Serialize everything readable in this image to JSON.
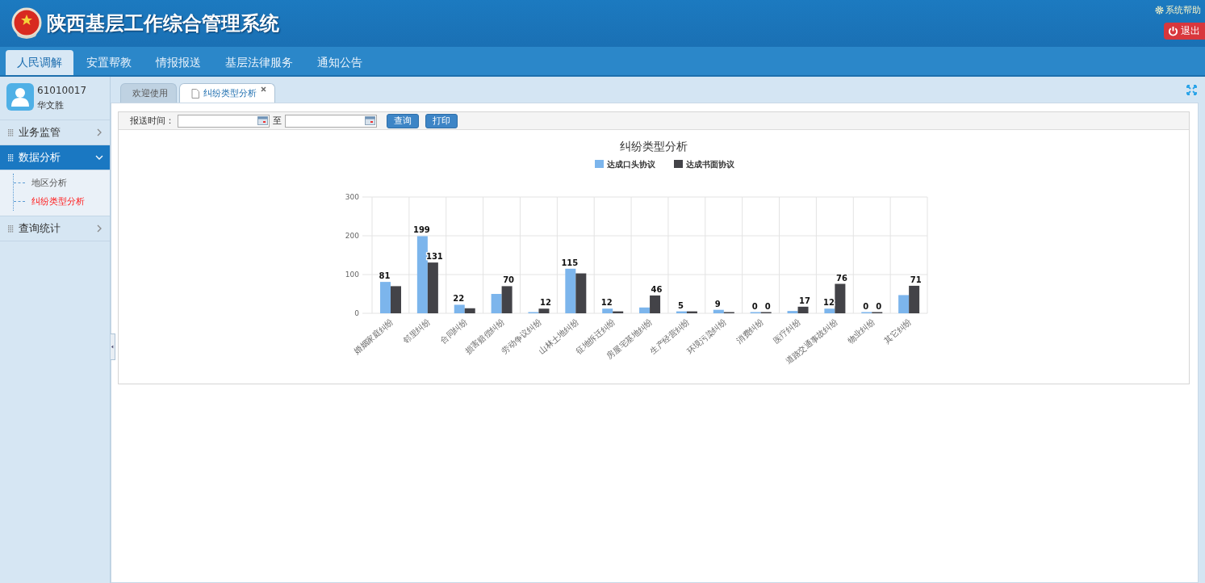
{
  "header": {
    "title": "陕西基层工作综合管理系统",
    "help": "系统帮助",
    "logout": "退出"
  },
  "nav": [
    {
      "label": "人民调解",
      "selected": true
    },
    {
      "label": "安置帮教",
      "selected": false
    },
    {
      "label": "情报报送",
      "selected": false
    },
    {
      "label": "基层法律服务",
      "selected": false
    },
    {
      "label": "通知公告",
      "selected": false
    }
  ],
  "user": {
    "id": "61010017",
    "name": "华文胜"
  },
  "sidebar": {
    "items": [
      {
        "label": "业务监管",
        "expanded": false,
        "selected": false
      },
      {
        "label": "数据分析",
        "expanded": true,
        "selected": true,
        "children": [
          {
            "label": "地区分析",
            "selected": false
          },
          {
            "label": "纠纷类型分析",
            "selected": true
          }
        ]
      },
      {
        "label": "查询统计",
        "expanded": false,
        "selected": false
      }
    ]
  },
  "tabs": [
    {
      "label": "欢迎使用",
      "selected": false,
      "closable": false
    },
    {
      "label": "纠纷类型分析",
      "selected": true,
      "closable": true
    }
  ],
  "filter": {
    "label": "报送时间：",
    "separator": "至",
    "buttons": [
      "查询",
      "打印"
    ]
  },
  "chart_data": {
    "type": "bar",
    "title": "纠纷类型分析",
    "categories": [
      "婚姻家庭纠纷",
      "邻里纠纷",
      "合同纠纷",
      "损害赔偿纠纷",
      "劳动争议纠纷",
      "山林土地纠纷",
      "征地拆迁纠纷",
      "房屋宅基地纠纷",
      "生产经营纠纷",
      "环境污染纠纷",
      "消费纠纷",
      "医疗纠纷",
      "道路交通事故纠纷",
      "物业纠纷",
      "其它纠纷"
    ],
    "series": [
      {
        "name": "达成口头协议",
        "color": "#7cb5ec",
        "values": [
          81,
          199,
          22,
          50,
          3,
          115,
          12,
          15,
          5,
          9,
          0,
          6,
          12,
          0,
          47
        ]
      },
      {
        "name": "达成书面协议",
        "color": "#434348",
        "values": [
          70,
          131,
          13,
          70,
          12,
          103,
          5,
          46,
          5,
          2,
          0,
          17,
          76,
          0,
          71
        ]
      }
    ],
    "legend": true,
    "ylim": [
      0,
      300
    ],
    "yticks": [
      0,
      100,
      200,
      300
    ],
    "value_labels": [
      [
        "81",
        "199",
        "22",
        null,
        null,
        "115",
        "12",
        null,
        "5",
        "9",
        "0",
        null,
        "12",
        "0",
        null
      ],
      [
        null,
        "131",
        null,
        "70",
        "12",
        null,
        null,
        "46",
        null,
        null,
        "0",
        "17",
        "76",
        "0",
        "71"
      ]
    ]
  }
}
